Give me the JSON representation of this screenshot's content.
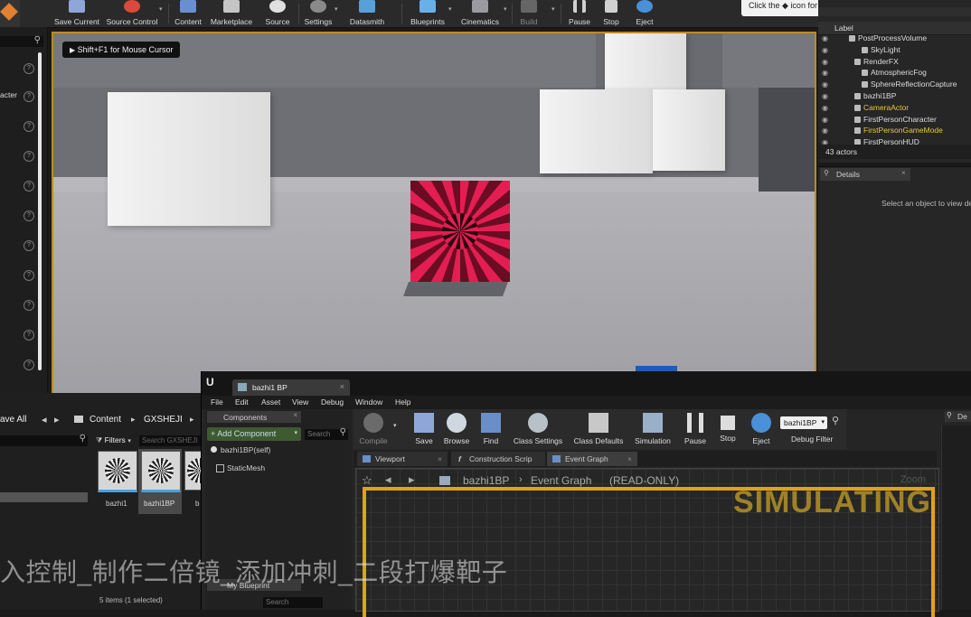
{
  "toolbar": {
    "buttons": [
      {
        "label": "Save Current",
        "color": "#8fa7d8"
      },
      {
        "label": "Source Control",
        "color": "#d84a3a"
      },
      {
        "label": "Content",
        "color": "#6a8fd0"
      },
      {
        "label": "Marketplace",
        "color": "#c5c5c5"
      },
      {
        "label": "Source",
        "color": "#e0e0e0"
      },
      {
        "label": "Settings",
        "color": "#8a8a8a"
      },
      {
        "label": "Datasmith",
        "color": "#5aa0d8"
      },
      {
        "label": "Blueprints",
        "color": "#6ab0e8"
      },
      {
        "label": "Cinematics",
        "color": "#9a9aa0"
      },
      {
        "label": "Build",
        "color": "#666666"
      },
      {
        "label": "Pause",
        "color": "#cfcfcf"
      },
      {
        "label": "Stop",
        "color": "#d0d0d0"
      },
      {
        "label": "Eject",
        "color": "#4a90d8"
      }
    ]
  },
  "tour_tip": "Click the ◆ icon for a tour of the tools.",
  "left_panel": {
    "partial_label": "acter"
  },
  "viewport": {
    "hint": "Shift+F1 for Mouse Cursor"
  },
  "outliner": {
    "column_label": "Label",
    "rows": [
      {
        "label": "PostProcessVolume",
        "indent": 44,
        "color": "#dddddd"
      },
      {
        "label": "SkyLight",
        "indent": 58,
        "color": "#dddddd"
      },
      {
        "label": "RenderFX",
        "indent": 50,
        "color": "#dddddd"
      },
      {
        "label": "AtmosphericFog",
        "indent": 58,
        "color": "#dddddd"
      },
      {
        "label": "SphereReflectionCapture",
        "indent": 58,
        "color": "#dddddd"
      },
      {
        "label": "bazhi1BP",
        "indent": 50,
        "color": "#dddddd"
      },
      {
        "label": "CameraActor",
        "indent": 50,
        "color": "#e8c64a"
      },
      {
        "label": "FirstPersonCharacter",
        "indent": 50,
        "color": "#dddddd"
      },
      {
        "label": "FirstPersonGameMode",
        "indent": 50,
        "color": "#e8c64a"
      },
      {
        "label": "FirstPersonHUD",
        "indent": 50,
        "color": "#dddddd"
      }
    ],
    "count": "43 actors"
  },
  "details": {
    "tab": "Details",
    "placeholder": "Select an object to view de"
  },
  "content_browser": {
    "save_all": "ave All",
    "path_root": "Content",
    "path_folder": "GXSHEJI",
    "filters": "Filters",
    "search_placeholder": "Search GXSHEJI",
    "assets": [
      {
        "name": "bazhi1"
      },
      {
        "name": "bazhi1BP"
      },
      {
        "name": "b"
      }
    ],
    "status": "5 items (1 selected)"
  },
  "blueprint": {
    "tab_title": "bazhi1 BP",
    "menus": [
      "File",
      "Edit",
      "Asset",
      "View",
      "Debug",
      "Window",
      "Help"
    ],
    "components_tab": "Components",
    "add_component": "+ Add Component",
    "search_placeholder": "Search",
    "self_label": "bazhi1BP(self)",
    "static_mesh": "StaticMesh",
    "my_blueprint": "My Blueprint",
    "tools": [
      {
        "label": "Compile"
      },
      {
        "label": "Save"
      },
      {
        "label": "Browse"
      },
      {
        "label": "Find"
      },
      {
        "label": "Class Settings"
      },
      {
        "label": "Class Defaults"
      },
      {
        "label": "Simulation"
      },
      {
        "label": "Pause"
      },
      {
        "label": "Stop"
      },
      {
        "label": "Eject"
      }
    ],
    "debug_value": "bazhi1BP",
    "debug_filter": "Debug Filter",
    "graph_tabs": [
      "Viewport",
      "Construction Scrip",
      "Event Graph"
    ],
    "breadcrumb_bp": "bazhi1BP",
    "breadcrumb_graph": "Event Graph",
    "read_only": "(READ-ONLY)",
    "zoom": "Zoom",
    "simulating": "SIMULATING",
    "details_partial": "De"
  },
  "subtitle": "入控制_制作二倍镜_添加冲刺_二段打爆靶子"
}
